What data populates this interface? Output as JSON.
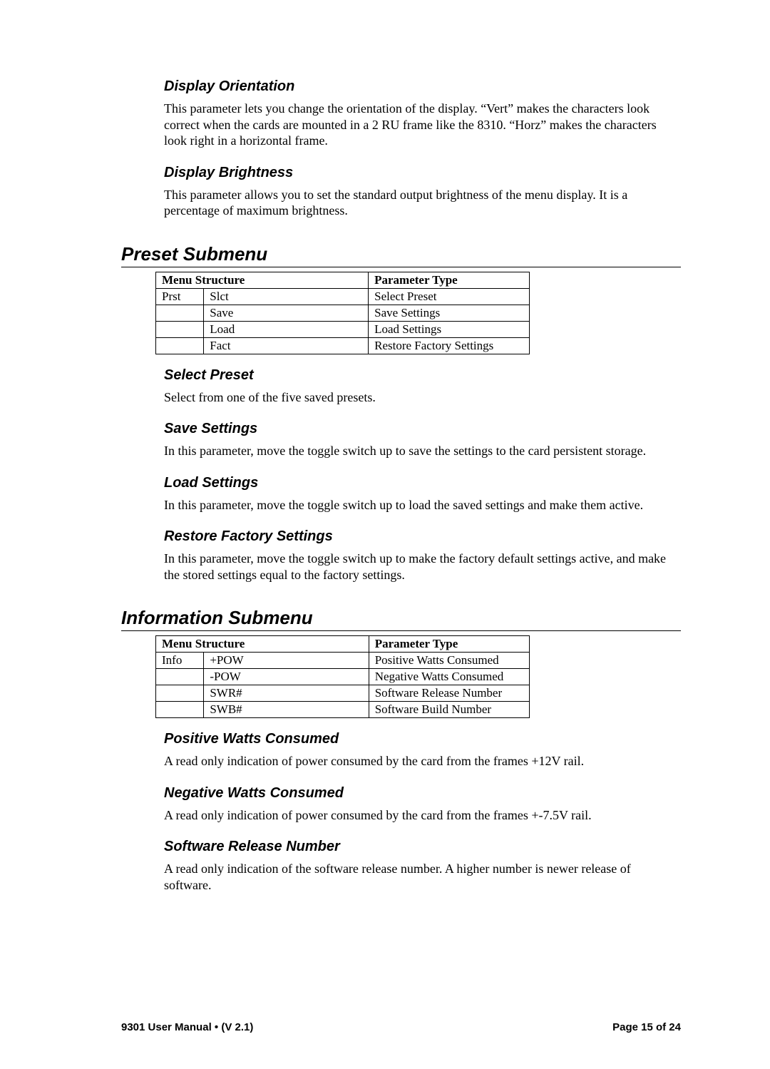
{
  "sections": {
    "display_orientation": {
      "heading": "Display Orientation",
      "body": "This parameter lets you change the orientation of the display. “Vert” makes the characters look correct when the cards are mounted in a 2 RU frame like the 8310. “Horz” makes the characters look right in a horizontal frame."
    },
    "display_brightness": {
      "heading": "Display Brightness",
      "body": "This parameter allows you to set the standard output brightness of the menu display. It is a percentage of maximum brightness."
    },
    "preset_submenu_heading": "Preset Submenu",
    "preset_table": {
      "header_menu": "Menu Structure",
      "header_param": "Parameter Type",
      "group": "Prst",
      "rows": [
        {
          "code": "Slct",
          "desc": "Select Preset"
        },
        {
          "code": "Save",
          "desc": "Save Settings"
        },
        {
          "code": "Load",
          "desc": "Load Settings"
        },
        {
          "code": "Fact",
          "desc": "Restore Factory Settings"
        }
      ]
    },
    "select_preset": {
      "heading": "Select Preset",
      "body": "Select from one of the five saved presets."
    },
    "save_settings": {
      "heading": "Save Settings",
      "body": "In this parameter, move the toggle switch up to save the settings to the card persistent storage."
    },
    "load_settings": {
      "heading": "Load Settings",
      "body": "In this parameter, move the toggle switch up to load the saved settings and make them active."
    },
    "restore_factory": {
      "heading": "Restore Factory Settings",
      "body": "In this parameter, move the toggle switch up to make the factory default settings active, and make the stored settings equal to the factory settings."
    },
    "info_submenu_heading": "Information Submenu",
    "info_table": {
      "header_menu": "Menu Structure",
      "header_param": "Parameter Type",
      "group": "Info",
      "rows": [
        {
          "code": "+POW",
          "desc": "Positive Watts Consumed"
        },
        {
          "code": "-POW",
          "desc": "Negative Watts Consumed"
        },
        {
          "code": "SWR#",
          "desc": "Software Release Number"
        },
        {
          "code": "SWB#",
          "desc": "Software Build Number"
        }
      ]
    },
    "pos_watts": {
      "heading": "Positive Watts Consumed",
      "body": "A read only indication of power consumed by the card from the frames +12V rail."
    },
    "neg_watts": {
      "heading": "Negative Watts Consumed",
      "body": "A read only indication of power consumed by the card from the frames +-7.5V rail."
    },
    "sw_release": {
      "heading": "Software Release Number",
      "body": "A read only indication of the software release number. A higher number is newer release of software."
    }
  },
  "footer": {
    "left": "9301 User Manual  •  (V 2.1)",
    "right": "Page 15 of 24"
  }
}
